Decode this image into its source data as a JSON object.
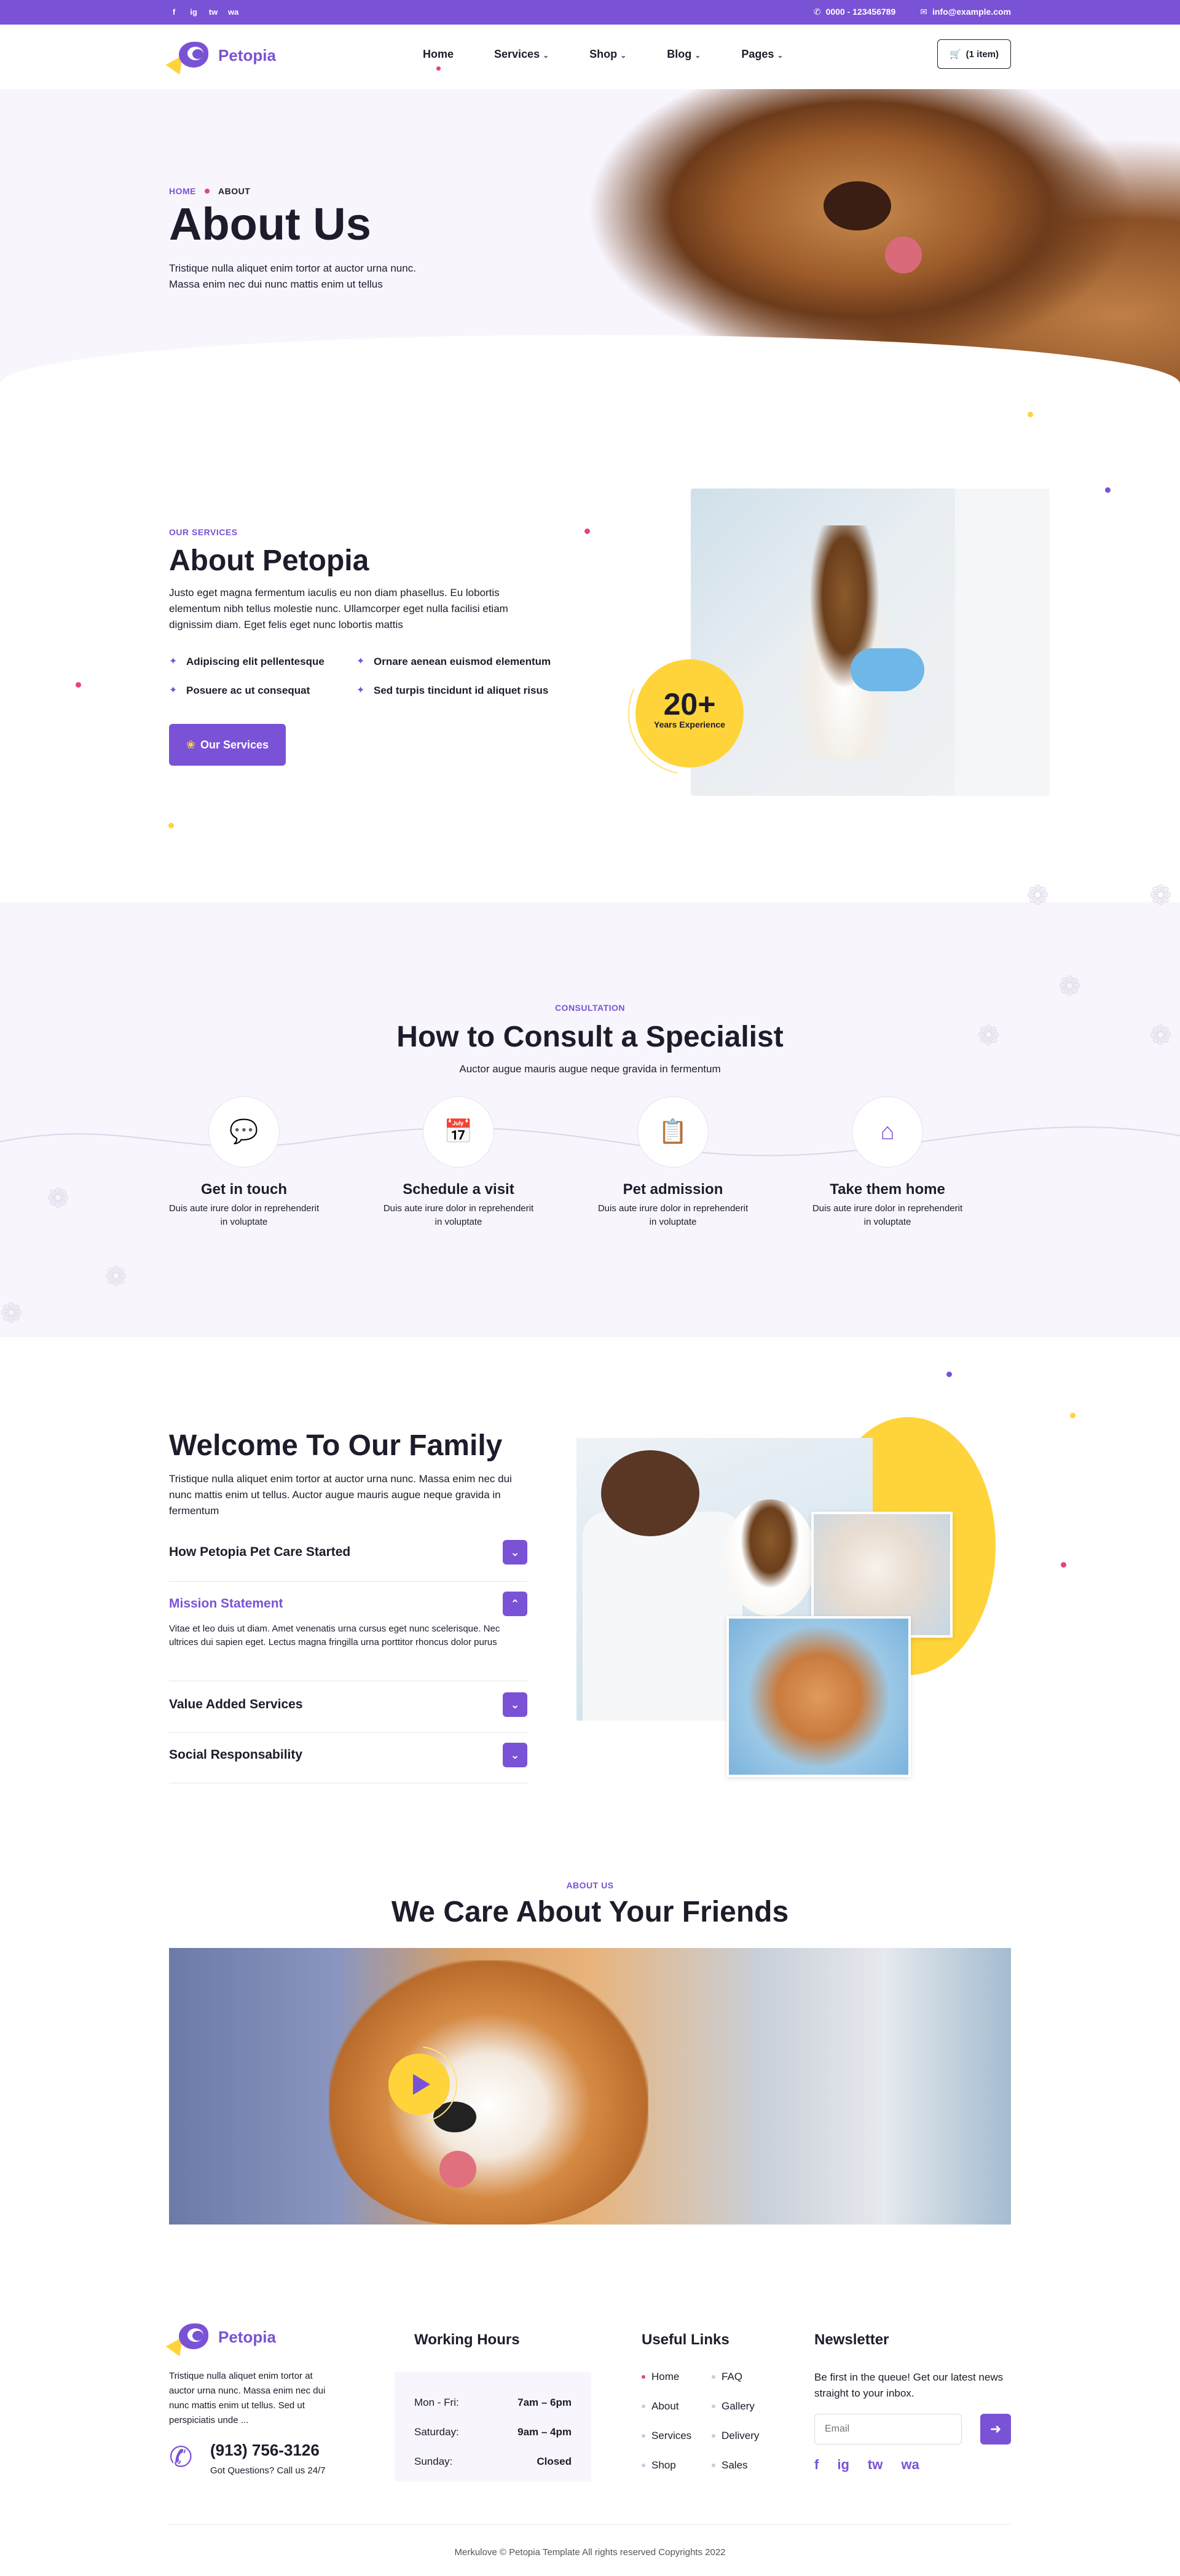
{
  "topbar": {
    "social": [
      "f",
      "ig",
      "tw",
      "wa"
    ],
    "phone": "0000 - 123456789",
    "email": "info@example.com",
    "phone_icon": "phone-icon",
    "email_icon": "mail-icon"
  },
  "header": {
    "logo_text": "Petopia",
    "nav": [
      {
        "label": "Home",
        "active": true
      },
      {
        "label": "Services",
        "dropdown": true
      },
      {
        "label": "Shop",
        "dropdown": true
      },
      {
        "label": "Blog",
        "dropdown": true
      },
      {
        "label": "Pages",
        "dropdown": true
      }
    ],
    "cart_label": "(1 item)"
  },
  "hero": {
    "crumb_home": "HOME",
    "crumb_current": "ABOUT",
    "title": "About Us",
    "text": "Tristique nulla aliquet enim tortor at auctor urna nunc. Massa enim nec dui nunc mattis enim ut tellus"
  },
  "about": {
    "tag": "OUR SERVICES",
    "title": "About Petopia",
    "text": "Justo eget magna fermentum iaculis eu non diam phasellus. Eu lobortis elementum nibh tellus molestie nunc. Ullamcorper eget nulla facilisi etiam dignissim diam. Eget felis eget nunc lobortis mattis",
    "features": [
      "Adipiscing elit pellentesque",
      "Ornare aenean euismod elementum",
      "Posuere ac ut consequat",
      "Sed turpis tincidunt id aliquet risus"
    ],
    "button": "Our Services",
    "badge_number": "20+",
    "badge_label": "Years Experience"
  },
  "consult": {
    "tag": "CONSULTATION",
    "title": "How to Consult a Specialist",
    "subtitle": "Auctor augue mauris augue neque gravida in fermentum",
    "steps": [
      {
        "title": "Get in touch",
        "text": "Duis aute irure dolor in reprehenderit in voluptate",
        "icon": "chat-icon"
      },
      {
        "title": "Schedule a visit",
        "text": "Duis aute irure dolor in reprehenderit in voluptate",
        "icon": "calendar-check-icon"
      },
      {
        "title": "Pet admission",
        "text": "Duis aute irure dolor in reprehenderit in voluptate",
        "icon": "clipboard-icon"
      },
      {
        "title": "Take them home",
        "text": "Duis aute irure dolor in reprehenderit in voluptate",
        "icon": "home-icon"
      }
    ]
  },
  "welcome": {
    "title": "Welcome To Our Family",
    "text": "Tristique nulla aliquet enim tortor at auctor urna nunc. Massa enim nec dui nunc mattis enim ut tellus. Auctor augue mauris augue neque gravida in fermentum",
    "accordion": [
      {
        "title": "How Petopia Pet Care Started",
        "open": false
      },
      {
        "title": "Mission Statement",
        "open": true,
        "body": "Vitae et leo duis ut diam. Amet venenatis urna cursus eget nunc scelerisque. Nec ultrices dui sapien eget. Lectus magna fringilla urna porttitor rhoncus dolor purus"
      },
      {
        "title": "Value Added Services",
        "open": false
      },
      {
        "title": "Social Responsability",
        "open": false
      }
    ]
  },
  "care": {
    "tag": "ABOUT US",
    "title": "We Care About Your Friends"
  },
  "footer": {
    "logo_text": "Petopia",
    "text": "Tristique nulla aliquet enim tortor at auctor urna nunc. Massa enim nec dui nunc mattis enim ut tellus. Sed ut perspiciatis unde ...",
    "phone": "(913) 756-3126",
    "phone_caption": "Got Questions? Call us 24/7",
    "hours_title": "Working Hours",
    "hours": [
      {
        "day": "Mon - Fri:",
        "time": "7am – 6pm"
      },
      {
        "day": "Saturday:",
        "time": "9am – 4pm"
      },
      {
        "day": "Sunday:",
        "time": "Closed"
      }
    ],
    "links_title": "Useful Links",
    "links_col1": [
      "Home",
      "About",
      "Services",
      "Shop"
    ],
    "links_col2": [
      "FAQ",
      "Gallery",
      "Delivery",
      "Sales"
    ],
    "newsletter_title": "Newsletter",
    "newsletter_text": "Be first in the queue! Get our latest news straight to your inbox.",
    "email_placeholder": "Email",
    "social": [
      "f",
      "ig",
      "tw",
      "wa"
    ],
    "copyright": "Merkulove © Petopia Template All rights reserved Copyrights 2022"
  }
}
